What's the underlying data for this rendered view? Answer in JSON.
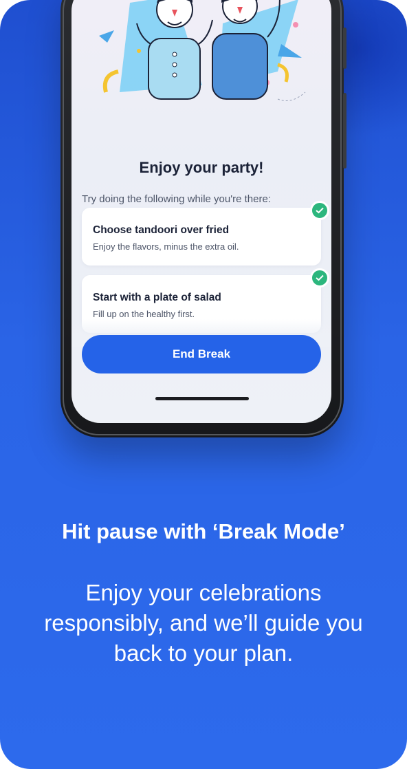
{
  "screen": {
    "title": "Enjoy your party!",
    "subtitle": "Try doing the following while you're there:",
    "tips": [
      {
        "title": "Choose tandoori over fried",
        "subtitle": "Enjoy the flavors, minus the extra oil.",
        "checked": true
      },
      {
        "title": "Start with a plate of salad",
        "subtitle": "Fill up on the healthy first.",
        "checked": true
      }
    ],
    "end_button_label": "End Break"
  },
  "promo": {
    "headline": "Hit pause with ‘Break Mode’",
    "body": "Enjoy your celebrations responsibly, and we’ll guide you back to your plan."
  },
  "colors": {
    "background": "#2a64e6",
    "button": "#2563e8",
    "check": "#2cb67d",
    "text_dark": "#1b2237"
  },
  "icons": [
    "check-icon",
    "party-illustration"
  ]
}
